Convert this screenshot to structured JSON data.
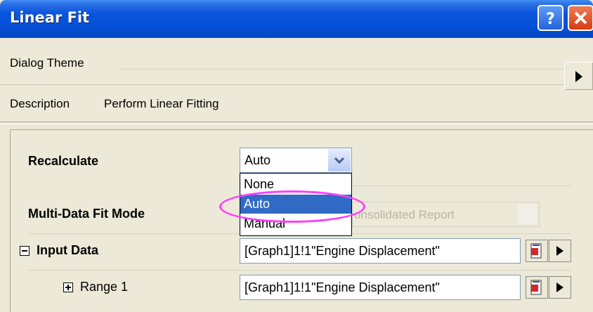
{
  "window": {
    "title": "Linear Fit"
  },
  "header": {
    "dialog_theme_label": "Dialog Theme",
    "description_label": "Description",
    "description_value": "Perform Linear Fitting"
  },
  "tree": {
    "recalculate": {
      "label": "Recalculate",
      "value": "Auto",
      "options": [
        "None",
        "Auto",
        "Manual"
      ],
      "selected_option": "Auto"
    },
    "multi_data_fit_mode": {
      "label": "Multi-Data Fit Mode",
      "value_partial": "onsolidated Report"
    },
    "input_data": {
      "label": "Input Data",
      "value": "[Graph1]1!1\"Engine Displacement\""
    },
    "range1": {
      "label": "Range 1",
      "value": "[Graph1]1!1\"Engine Displacement\""
    }
  },
  "colors": {
    "titlebar": "#0550d8",
    "selection": "#316ac5",
    "annotation_ellipse": "#ff3cff"
  }
}
